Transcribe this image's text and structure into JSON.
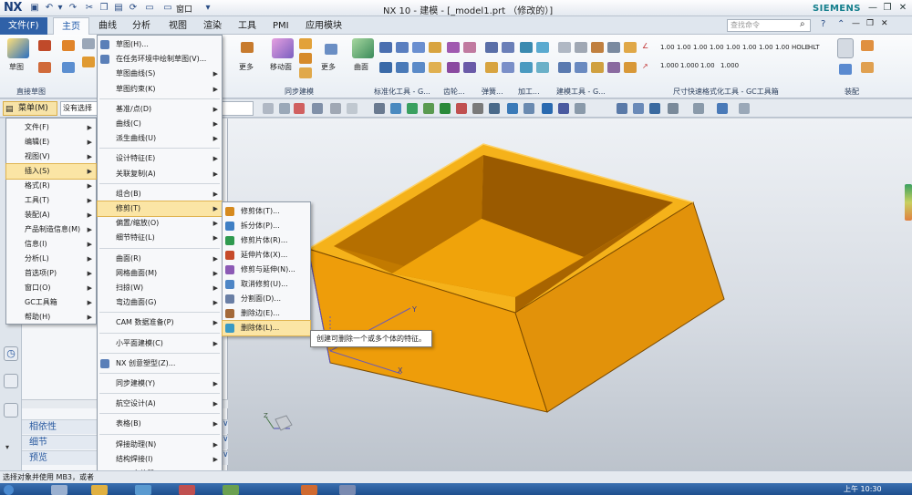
{
  "app": {
    "title": "NX 10 - 建模 - [_model1.prt （修改的）]",
    "logo": "NX",
    "brand": "SIEMENS",
    "window_label": "窗口"
  },
  "tabs": [
    "文件(F)",
    "主页",
    "曲线",
    "分析",
    "视图",
    "渲染",
    "工具",
    "PMI",
    "应用模块"
  ],
  "active_tab": "主页",
  "search": {
    "placeholder": "查找命令"
  },
  "ribbon": {
    "labels": {
      "sketch": "草图",
      "more1": "更多",
      "move_face": "移动面",
      "more2": "更多",
      "surface": "曲面",
      "more3": "更多"
    },
    "groups": [
      "直接草图",
      "同步建模",
      "标准化工具 - G...",
      "齿轮...",
      "弹簧...",
      "加工...",
      "建模工具 - G...",
      "尺寸快速格式化工具 - GC工具箱",
      "装配"
    ],
    "dim_values": [
      "1.00",
      "1.00",
      "1.00",
      "1.00",
      "1.00",
      "1.00",
      "1.00",
      "1.00",
      "HOLE",
      "HLT",
      "1.000",
      "1.000",
      "1.00",
      "1.000"
    ]
  },
  "toolbar": {
    "menu_label": "菜单(M)",
    "filter_label": "没有选择"
  },
  "menu_main": [
    {
      "label": "文件(F)",
      "arrow": true
    },
    {
      "label": "编辑(E)",
      "arrow": true
    },
    {
      "label": "视图(V)",
      "arrow": true
    },
    {
      "label": "插入(S)",
      "arrow": true,
      "highlight": true
    },
    {
      "label": "格式(R)",
      "arrow": true
    },
    {
      "label": "工具(T)",
      "arrow": true
    },
    {
      "label": "装配(A)",
      "arrow": true
    },
    {
      "label": "产品制造信息(M)",
      "arrow": true
    },
    {
      "label": "信息(I)",
      "arrow": true
    },
    {
      "label": "分析(L)",
      "arrow": true
    },
    {
      "label": "首选项(P)",
      "arrow": true
    },
    {
      "label": "窗口(O)",
      "arrow": true
    },
    {
      "label": "GC工具箱",
      "arrow": true
    },
    {
      "label": "帮助(H)",
      "arrow": true
    }
  ],
  "menu_insert": [
    {
      "label": "草图(H)...",
      "icon": true
    },
    {
      "label": "在任务环境中绘制草图(V)...",
      "icon": true
    },
    {
      "label": "草图曲线(S)",
      "arrow": true
    },
    {
      "label": "草图约束(K)",
      "arrow": true
    },
    {
      "label": "基准/点(D)",
      "arrow": true,
      "sep": true
    },
    {
      "label": "曲线(C)",
      "arrow": true
    },
    {
      "label": "派生曲线(U)",
      "arrow": true
    },
    {
      "label": "设计特征(E)",
      "arrow": true,
      "sep": true
    },
    {
      "label": "关联复制(A)",
      "arrow": true
    },
    {
      "label": "组合(B)",
      "arrow": true,
      "sep": true
    },
    {
      "label": "修剪(T)",
      "arrow": true,
      "highlight": true
    },
    {
      "label": "偏置/缩放(O)",
      "arrow": true
    },
    {
      "label": "细节特征(L)",
      "arrow": true
    },
    {
      "label": "曲面(R)",
      "arrow": true,
      "sep": true
    },
    {
      "label": "网格曲面(M)",
      "arrow": true
    },
    {
      "label": "扫掠(W)",
      "arrow": true
    },
    {
      "label": "弯边曲面(G)",
      "arrow": true
    },
    {
      "label": "CAM 数据准备(P)",
      "arrow": true,
      "sep": true
    },
    {
      "label": "小平面建模(C)",
      "arrow": true,
      "sep": true
    },
    {
      "label": "NX 创意塑型(Z)...",
      "icon": true,
      "sep": true
    },
    {
      "label": "同步建模(Y)",
      "arrow": true,
      "sep": true
    },
    {
      "label": "航空设计(A)",
      "arrow": true,
      "sep": true
    },
    {
      "label": "表格(B)",
      "arrow": true,
      "sep": true
    },
    {
      "label": "焊接助理(N)",
      "arrow": true,
      "sep": true
    },
    {
      "label": "结构焊接(I)",
      "arrow": true
    },
    {
      "label": "BIW 定位器",
      "arrow": true
    }
  ],
  "menu_trim": [
    {
      "label": "修剪体(T)...",
      "color": "#d68a1e"
    },
    {
      "label": "拆分体(P)...",
      "color": "#3f7fc4"
    },
    {
      "label": "修剪片体(R)...",
      "color": "#2f9a4f"
    },
    {
      "label": "延伸片体(X)...",
      "color": "#c64a2a"
    },
    {
      "label": "修剪与延伸(N)...",
      "color": "#8c5ab5"
    },
    {
      "label": "取消修剪(U)...",
      "color": "#4e86c6"
    },
    {
      "label": "分割面(D)...",
      "color": "#6a7fa5"
    },
    {
      "label": "删除边(E)...",
      "color": "#a46a3a"
    },
    {
      "label": "删除体(L)...",
      "color": "#3a9ac4",
      "highlight": true
    }
  ],
  "tooltip": "创建可删除一个或多个体的特征。",
  "nav_sections": [
    "相依性",
    "细节",
    "预览"
  ],
  "status": "选择对象并使用 MB3，或者",
  "clock": "上午 10:30",
  "colors": {
    "accent": "#2f61a8",
    "highlight": "#fbe5a5",
    "model": "#f0a30a"
  }
}
